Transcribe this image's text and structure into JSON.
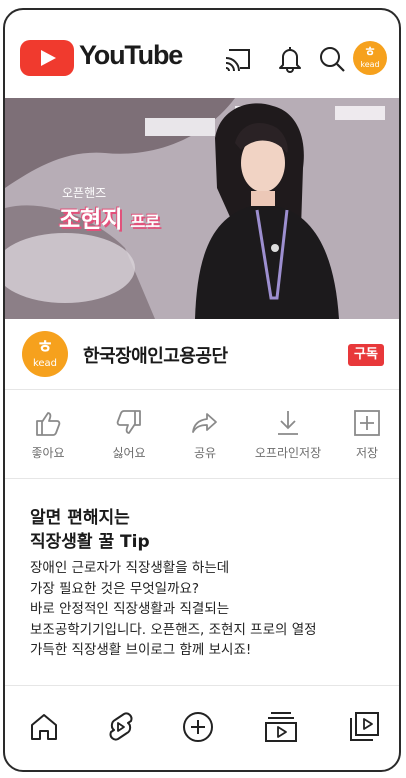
{
  "header": {
    "brand": "YouTube",
    "avatar_glyph": "ㅎ",
    "avatar_text": "kead",
    "icons": [
      "cast-icon",
      "bell-icon",
      "search-icon"
    ]
  },
  "video": {
    "caption_small": "오픈핸즈",
    "caption_name": "조현지",
    "caption_suffix": "프로"
  },
  "channel": {
    "name": "한국장애인고용공단",
    "logo_glyph": "ㅎ",
    "logo_text": "kead",
    "subscribe_label": "구독"
  },
  "actions": [
    {
      "label": "좋아요",
      "icon": "thumbs-up-icon"
    },
    {
      "label": "싫어요",
      "icon": "thumbs-down-icon"
    },
    {
      "label": "공유",
      "icon": "share-icon"
    },
    {
      "label": "오프라인저장",
      "icon": "download-icon"
    },
    {
      "label": "저장",
      "icon": "add-to-playlist-icon"
    }
  ],
  "description": {
    "title_line1": "알면 편해지는",
    "title_line2": "직장생활 꿀 Tip",
    "lines": [
      "장애인 근로자가 직장생활을 하는데",
      "가장 필요한 것은 무엇일까요?",
      "바로 안정적인 직장생활과 직결되는",
      "보조공학기기입니다. 오픈핸즈, 조현지 프로의 열정",
      "가득한 직장생활 브이로그 함께 보시죠!"
    ]
  },
  "bottom_nav": [
    "home-icon",
    "shorts-icon",
    "create-icon",
    "subscriptions-icon",
    "library-icon"
  ],
  "colors": {
    "brand_red": "#f03a2e",
    "subscribe_red": "#e8383a",
    "kead_orange": "#f6a11d"
  }
}
